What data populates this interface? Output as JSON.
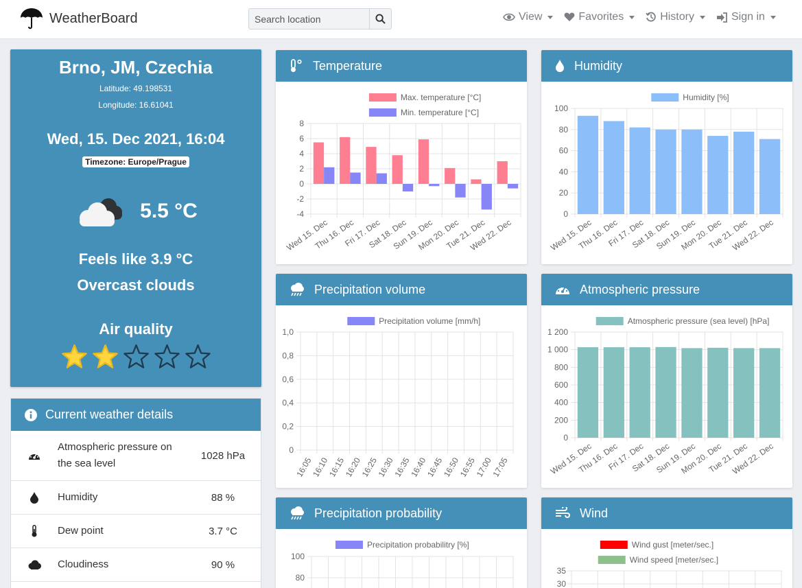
{
  "nav": {
    "brand": "WeatherBoard",
    "search_placeholder": "Search location",
    "items": [
      {
        "label": "View",
        "icon": "eye-icon"
      },
      {
        "label": "Favorites",
        "icon": "heart-icon"
      },
      {
        "label": "History",
        "icon": "history-icon"
      },
      {
        "label": "Sign in",
        "icon": "sign-in-icon"
      }
    ]
  },
  "location": {
    "city": "Brno, JM, Czechia",
    "latitude": "Latitude: 49.198531",
    "longitude": "Longitude: 16.61041",
    "datetime": "Wed, 15. Dec 2021, 16:04",
    "timezone": "Timezone: Europe/Prague",
    "weather_icon": "cloud-icon",
    "temperature": "5.5 °C",
    "feels_like": "Feels like 3.9 °C",
    "description": "Overcast clouds",
    "air_quality_title": "Air quality",
    "air_quality_rating": 2,
    "air_quality_max": 5
  },
  "details": {
    "title": "Current weather details",
    "rows": [
      {
        "icon": "gauge-icon",
        "label": "Atmospheric pressure on the sea level",
        "value": "1028 hPa"
      },
      {
        "icon": "droplet-icon",
        "label": "Humidity",
        "value": "88 %"
      },
      {
        "icon": "thermometer-icon",
        "label": "Dew point",
        "value": "3.7 °C"
      },
      {
        "icon": "cloud-icon",
        "label": "Cloudiness",
        "value": "90 %"
      }
    ]
  },
  "colors": {
    "header": "#4590b8",
    "max_temp": "#ff7f92",
    "min_temp": "#8786f7",
    "humidity": "#8cbffa",
    "pressure": "#85c2bf",
    "precip": "#8786f7",
    "wind_gust": "#ff0000",
    "wind_speed": "#8fbf8a",
    "star": "#fcd53f"
  },
  "cards": {
    "temperature": "Temperature",
    "humidity": "Humidity",
    "precip_volume": "Precipitation volume",
    "pressure": "Atmospheric pressure",
    "precip_prob": "Precipitation probability",
    "wind": "Wind"
  },
  "chart_data": [
    {
      "id": "temperature",
      "type": "bar",
      "categories": [
        "Wed 15. Dec",
        "Thu 16. Dec",
        "Fri 17. Dec",
        "Sat 18. Dec",
        "Sun 19. Dec",
        "Mon 20. Dec",
        "Tue 21. Dec",
        "Wed 22. Dec"
      ],
      "series": [
        {
          "name": "Max. temperature [°C]",
          "values": [
            5.5,
            6.2,
            4.9,
            3.8,
            5.9,
            2.1,
            0.6,
            3.0
          ]
        },
        {
          "name": "Min. temperature [°C]",
          "values": [
            2.2,
            1.5,
            1.4,
            -1.0,
            -0.3,
            -1.8,
            -3.4,
            -0.6
          ]
        }
      ],
      "ylim": [
        -4,
        8
      ],
      "yticks": [
        "8",
        "6",
        "4",
        "2",
        "0",
        "-2",
        "-4"
      ],
      "legend": "top"
    },
    {
      "id": "humidity",
      "type": "bar",
      "categories": [
        "Wed 15. Dec",
        "Thu 16. Dec",
        "Fri 17. Dec",
        "Sat 18. Dec",
        "Sun 19. Dec",
        "Mon 20. Dec",
        "Tue 21. Dec",
        "Wed 22. Dec"
      ],
      "series": [
        {
          "name": "Humidity [%]",
          "values": [
            93,
            88,
            82,
            80,
            80,
            74,
            78,
            71
          ]
        }
      ],
      "ylim": [
        0,
        100
      ],
      "yticks": [
        "100",
        "80",
        "60",
        "40",
        "20",
        "0"
      ],
      "legend": "top"
    },
    {
      "id": "precip_volume",
      "type": "bar",
      "categories": [
        "16:05",
        "16:10",
        "16:15",
        "16:20",
        "16:25",
        "16:30",
        "16:35",
        "16:40",
        "16:45",
        "16:50",
        "16:55",
        "17:00",
        "17:05"
      ],
      "series": [
        {
          "name": "Precipitation volume [mm/h]",
          "values": [
            0,
            0,
            0,
            0,
            0,
            0,
            0,
            0,
            0,
            0,
            0,
            0,
            0
          ]
        }
      ],
      "ylim": [
        0,
        1
      ],
      "yticks": [
        "1,0",
        "0,8",
        "0,6",
        "0,4",
        "0,2",
        "0"
      ],
      "legend": "top"
    },
    {
      "id": "pressure",
      "type": "bar",
      "categories": [
        "Wed 15. Dec",
        "Thu 16. Dec",
        "Fri 17. Dec",
        "Sat 18. Dec",
        "Sun 19. Dec",
        "Mon 20. Dec",
        "Tue 21. Dec",
        "Wed 22. Dec"
      ],
      "series": [
        {
          "name": "Atmospheric pressure (sea level) [hPa]",
          "values": [
            1028,
            1028,
            1028,
            1030,
            1018,
            1022,
            1018,
            1018
          ]
        }
      ],
      "ylim": [
        0,
        1200
      ],
      "yticks": [
        "1 200",
        "1 000",
        "800",
        "600",
        "400",
        "200",
        "0"
      ],
      "legend": "top"
    },
    {
      "id": "precip_prob",
      "type": "bar",
      "series": [
        {
          "name": "Precipitation probabilitry [%]"
        }
      ],
      "ylim": [
        0,
        100
      ],
      "yticks": [
        "100",
        "80"
      ],
      "legend": "top"
    },
    {
      "id": "wind",
      "type": "line",
      "series": [
        {
          "name": "Wind gust [meter/sec.]"
        },
        {
          "name": "Wind speed [meter/sec.]"
        }
      ],
      "yticks": [
        "35",
        "30"
      ],
      "legend": "top"
    }
  ]
}
